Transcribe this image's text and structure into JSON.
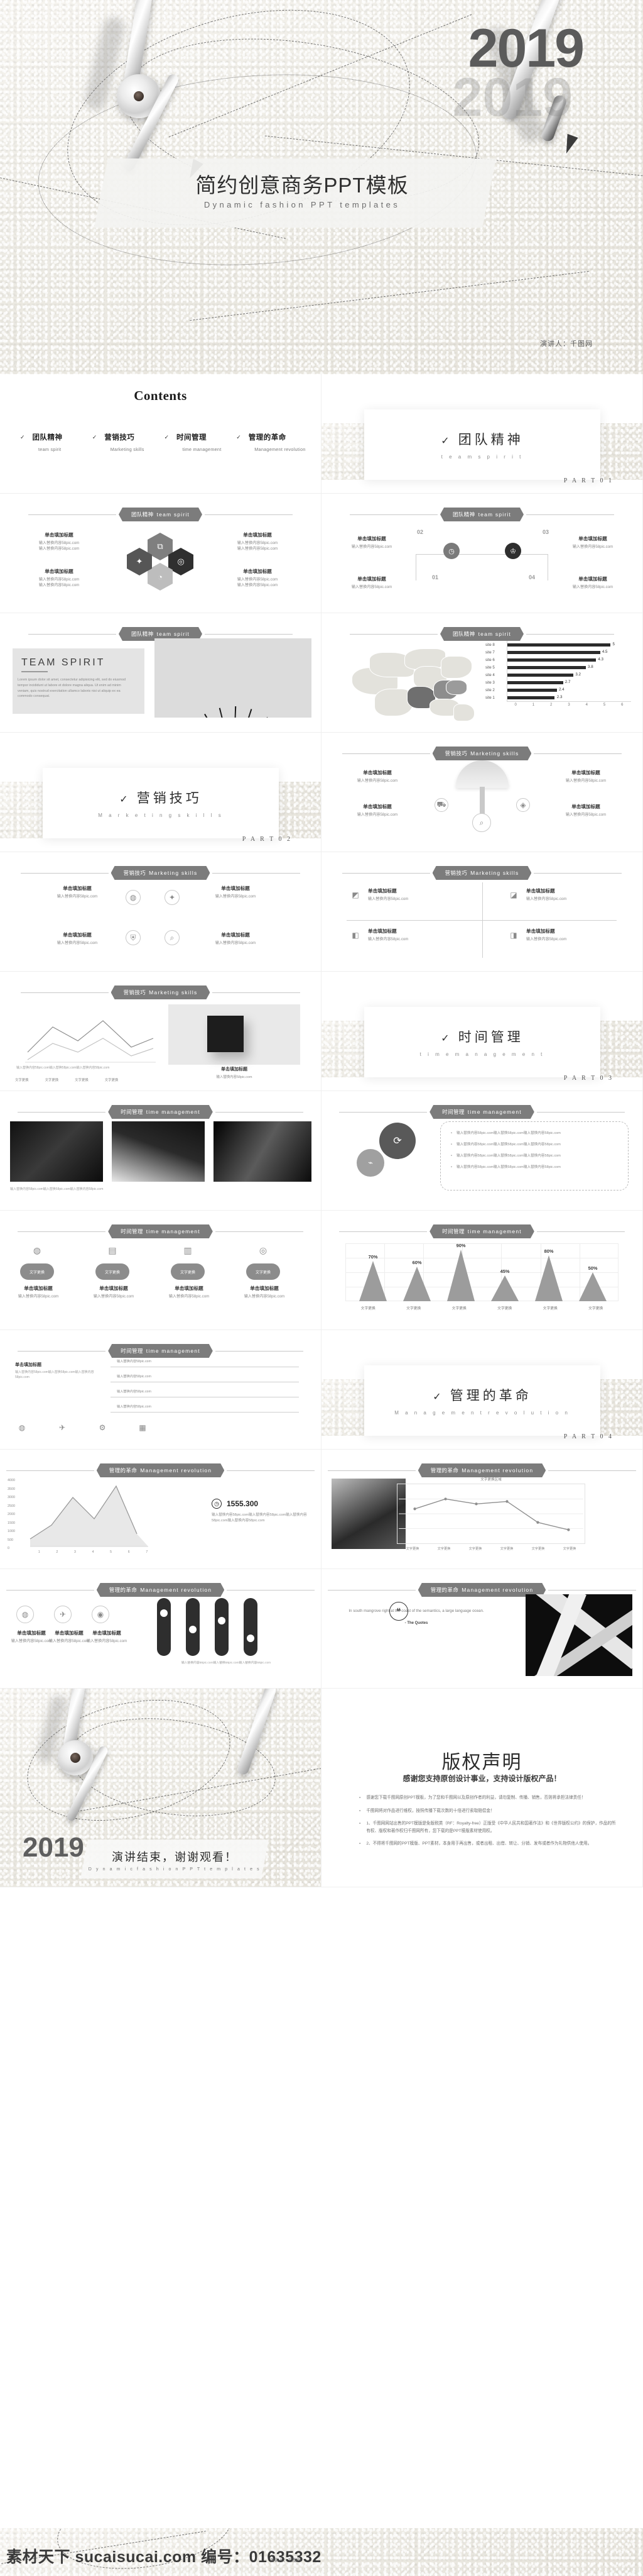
{
  "cover": {
    "year": "2019",
    "year_ghost": "2019",
    "title_cn": "简约创意商务PPT模板",
    "title_en": "Dynamic  fashion  PPT  templates",
    "presenter": "演讲人：千图网"
  },
  "contents": {
    "heading": "Contents",
    "items": [
      {
        "check": "✓",
        "cn": "团队精神",
        "en": "team spirit"
      },
      {
        "check": "✓",
        "cn": "营销技巧",
        "en": "Marketing  skills"
      },
      {
        "check": "✓",
        "cn": "时间管理",
        "en": "time management"
      },
      {
        "check": "✓",
        "cn": "管理的革命",
        "en": "Management  revolution"
      }
    ]
  },
  "sections": [
    {
      "check": "✓",
      "cn": "团队精神",
      "en": "t e a m   s p i r i t",
      "part": "P A R T   0 1"
    },
    {
      "check": "✓",
      "cn": "营销技巧",
      "en": "M a r k e t i n g   s k i l l s",
      "part": "P A R T   0 2"
    },
    {
      "check": "✓",
      "cn": "时间管理",
      "en": "t i m e   m a n a g e m e n t",
      "part": "P A R T   0 3"
    },
    {
      "check": "✓",
      "cn": "管理的革命",
      "en": "M a n a g e m e n t   r e v o l u t i o n",
      "part": "P A R T   0 4"
    }
  ],
  "tags": {
    "team": {
      "cn": "团队精神",
      "en": "team  spirit"
    },
    "marketing": {
      "cn": "营销技巧",
      "en": "Marketing  skills"
    },
    "time": {
      "cn": "时间管理",
      "en": "time  management"
    },
    "revolution": {
      "cn": "管理的革命",
      "en": "Management  revolution"
    }
  },
  "placeholder": {
    "title": "单击填加标题",
    "line": "输入替换内容58pic.com",
    "long": "输入替换内容58pic.com输入替换58pic.com输入替换内容58pic.com"
  },
  "team_spirit_panel": {
    "title": "TEAM  SPIRIT",
    "body": "Lorem ipsum dolor sit amet, consectetur adipisicing elit, sed do eiusmod tempor incididunt ut labore et dolore magna aliqua. Ut enim ad minim veniam, quis nostrud exercitation ullamco laboris nisi ut aliquip ex ea commodo consequat."
  },
  "process_numbers": [
    "01",
    "02",
    "03",
    "04"
  ],
  "kpi": {
    "value": "1555.300",
    "caption": "输入替换内容58pic.com输入替换内容58pic.com输入替换内容58pic.com输入替换内容58pic.com"
  },
  "quote": {
    "mark": "“",
    "text": "In south mangrove right at the coast of the semantics, a large language ocean.",
    "by": "- The Quotes"
  },
  "thanks": {
    "year": "2019",
    "cn": "演讲结束，谢谢观看！",
    "en": "D y n a m i c   f a s h i o n   P P T   t e m p l a t e s"
  },
  "copyright": {
    "title": "版权声明",
    "subtitle": "感谢您支持原创设计事业，支持设计版权产品！",
    "items": [
      "感谢您下载千图网原创PPT模板，为了您和千图网以及原创作者的利益，请勿复制、传播、销售，否则将承担法律责任！",
      "千图网将对作品进行维权，按照传播下载次数的十倍进行索取赔偿金！",
      "1、千图网网站出售的PPT模版是免版税类（RF：Royalty-free）正版受《中华人民共和国著作法》和《世界版权公约》的保护，作品的所有权、版权和著作权归千图网所有，您下载的是PPT模版素材使用权。",
      "2、不得将千图网的PPT模版、PPT素材，本身用于再出售，或者出租、出借、转让、分销、发布或者作为礼物供他人使用。"
    ]
  },
  "footer": {
    "watermark": "素材天下 sucaisucai.com  编号：01635332",
    "presenter": "演讲人：千图网"
  },
  "chart_data": [
    {
      "type": "bar",
      "orientation": "horizontal",
      "title": "",
      "categories": [
        "site 1",
        "site 2",
        "site 3",
        "site 4",
        "site 5",
        "site 6",
        "site 7",
        "site 8"
      ],
      "values": [
        2.3,
        2.4,
        2.7,
        3.2,
        3.8,
        4.3,
        4.5,
        5
      ],
      "xticks": [
        0,
        1,
        2,
        3,
        4,
        5,
        6
      ],
      "xlim": [
        0,
        6
      ],
      "xlabel": "",
      "ylabel": "",
      "grid": false,
      "legend": false,
      "bar_color": "#2b2b2b"
    },
    {
      "type": "area",
      "subtype": "mountain-peaks",
      "title": "",
      "categories": [
        "文字更换",
        "文字更换",
        "文字更换",
        "文字更换",
        "文字更换",
        "文字更换"
      ],
      "values": [
        70,
        60,
        90,
        45,
        80,
        50
      ],
      "value_labels": [
        "70%",
        "60%",
        "90%",
        "45%",
        "80%",
        "50%"
      ],
      "ylim": [
        0,
        100
      ],
      "grid": true,
      "legend": false,
      "fill_color": "#9c9c9c"
    },
    {
      "type": "line",
      "title": "",
      "categories": [
        "1",
        "2",
        "3",
        "4",
        "5",
        "6",
        "7"
      ],
      "series": [
        {
          "name": "series 1",
          "values": [
            500,
            1200,
            2600,
            1500,
            2400,
            3500,
            900
          ]
        }
      ],
      "yticks": [
        0,
        500,
        1000,
        1500,
        2000,
        2500,
        3000,
        3500,
        4000
      ],
      "ylim": [
        0,
        4000
      ],
      "grid": false,
      "legend": false,
      "line_color": "#9a9a9a"
    },
    {
      "type": "line",
      "title": "文字更换区域",
      "categories": [
        "文字更换",
        "文字更换",
        "文字更换",
        "文字更换",
        "文字更换",
        "文字更换"
      ],
      "series": [
        {
          "name": "series 1",
          "values": [
            62,
            78,
            70,
            74,
            40,
            30
          ]
        }
      ],
      "grid": true,
      "legend": false,
      "line_color": "#8e8e8e"
    }
  ]
}
